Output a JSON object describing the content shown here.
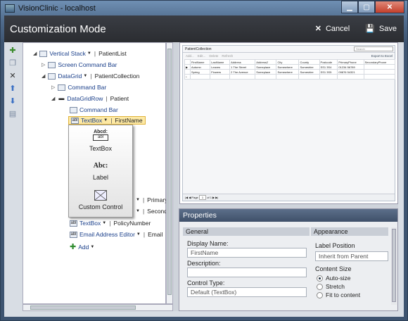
{
  "window": {
    "title": "VisionClinic - localhost"
  },
  "header": {
    "title": "Customization Mode",
    "cancel_label": "Cancel",
    "save_label": "Save",
    "cancel_icon": "✕",
    "save_icon": "💾"
  },
  "tree": {
    "vstack": "Vertical Stack",
    "vstack_bind": "PatientList",
    "screen_cmd": "Screen Command Bar",
    "datagrid": "DataGrid",
    "datagrid_bind": "PatientCollection",
    "cmdbar": "Command Bar",
    "dgrow": "DataGridRow",
    "dgrow_bind": "Patient",
    "cmdbar2": "Command Bar",
    "textbox_sel": "TextBox",
    "textbox_sel_bind": "FirstName",
    "primary": "PrimaryPh",
    "secondary": "Secondar",
    "textbox2": "TextBox",
    "textbox2_bind": "PolicyNumber",
    "email": "Email Address Editor",
    "email_bind": "Email",
    "add": "Add"
  },
  "popup": {
    "textbox_label": "TextBox",
    "textbox_preview": "Abcd:",
    "textbox_preview_box": "abl",
    "label_label": "Label",
    "label_preview": "Abc:",
    "custom_label": "Custom Control"
  },
  "preview": {
    "title": "PatientCollection",
    "search_placeholder": "Search",
    "toolbar": [
      "Add...",
      "Edit...",
      "Delete",
      "Refresh"
    ],
    "export": "Export to Excel",
    "columns": [
      "FirstName",
      "LastName",
      "Address",
      "Address2",
      "City",
      "County",
      "Postcode",
      "PrimaryPhone",
      "SecondaryPhone"
    ],
    "rows": [
      [
        "Autumn",
        "Leaves",
        "1 The Street",
        "Someplace",
        "Somewhere",
        "Someshire",
        "SS1 3S4",
        "01234 56789",
        ""
      ],
      [
        "Spring",
        "Flowers",
        "2 The Avenue",
        "Someplace",
        "Somewhere",
        "Someshire",
        "SS1 3S5",
        "09876 54321",
        ""
      ]
    ],
    "footer_page": "Page",
    "footer_page_num": "1",
    "footer_of": "of 1"
  },
  "properties": {
    "title": "Properties",
    "general": "General",
    "appearance": "Appearance",
    "display_name_label": "Display Name:",
    "display_name_value": "FirstName",
    "description_label": "Description:",
    "description_value": "",
    "control_type_label": "Control Type:",
    "control_type_value": "Default (TextBox)",
    "label_position_label": "Label Position",
    "label_position_value": "Inherit from Parent",
    "content_size_label": "Content Size",
    "sizes": [
      "Auto-size",
      "Stretch",
      "Fit to content"
    ]
  }
}
